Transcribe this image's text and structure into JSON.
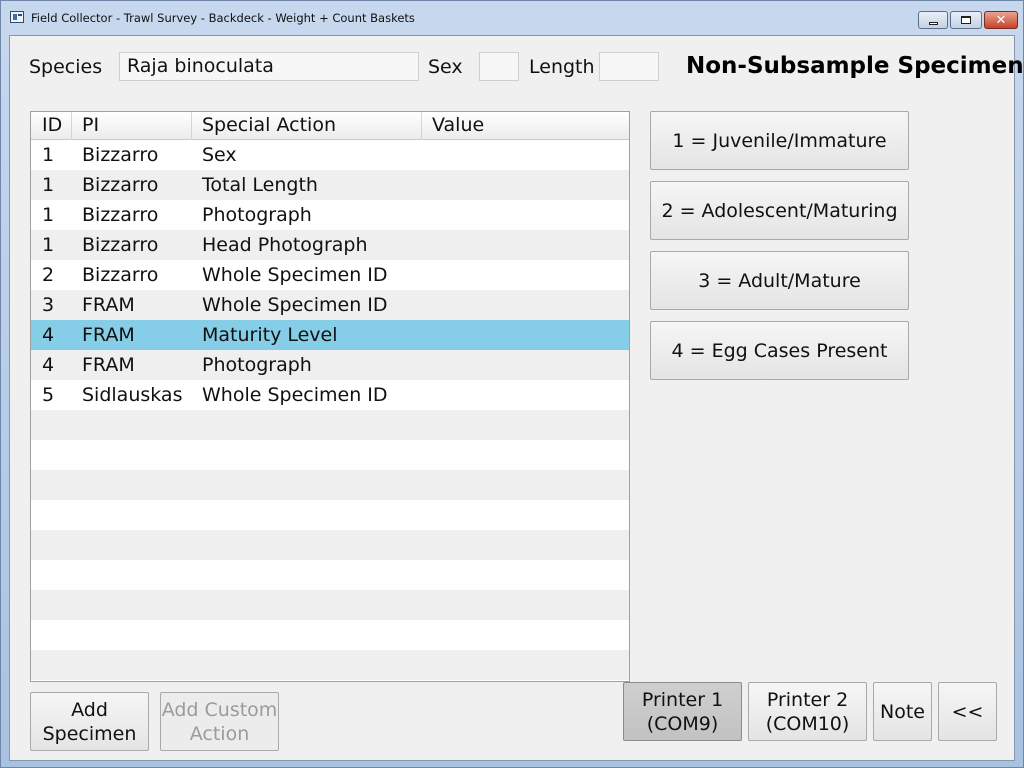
{
  "window": {
    "title": "Field Collector - Trawl Survey - Backdeck - Weight + Count Baskets",
    "minimize_label": "",
    "maximize_label": "",
    "close_label": "✕"
  },
  "form": {
    "species_label": "Species",
    "species_value": "Raja binoculata",
    "sex_label": "Sex",
    "sex_value": "",
    "length_label": "Length",
    "length_value": "",
    "heading": "Non-Subsample Specimen"
  },
  "table": {
    "columns": [
      "ID",
      "PI",
      "Special Action",
      "Value"
    ],
    "rows": [
      {
        "id": "1",
        "pi": "Bizzarro",
        "action": "Sex",
        "value": ""
      },
      {
        "id": "1",
        "pi": "Bizzarro",
        "action": "Total Length",
        "value": ""
      },
      {
        "id": "1",
        "pi": "Bizzarro",
        "action": "Photograph",
        "value": ""
      },
      {
        "id": "1",
        "pi": "Bizzarro",
        "action": "Head Photograph",
        "value": ""
      },
      {
        "id": "2",
        "pi": "Bizzarro",
        "action": "Whole Specimen ID",
        "value": ""
      },
      {
        "id": "3",
        "pi": "FRAM",
        "action": "Whole Specimen ID",
        "value": ""
      },
      {
        "id": "4",
        "pi": "FRAM",
        "action": "Maturity Level",
        "value": "",
        "selected": true
      },
      {
        "id": "4",
        "pi": "FRAM",
        "action": "Photograph",
        "value": ""
      },
      {
        "id": "5",
        "pi": "Sidlauskas",
        "action": "Whole Specimen ID",
        "value": ""
      }
    ],
    "empty_rows": 9,
    "selected_color": "#86cee8"
  },
  "maturity_options": [
    "1 = Juvenile/Immature",
    "2 = Adolescent/Maturing",
    "3 = Adult/Mature",
    "4 = Egg Cases Present"
  ],
  "bottom": {
    "add_specimen": [
      "Add",
      "Specimen"
    ],
    "add_custom_action": [
      "Add Custom",
      "Action"
    ],
    "printer1": [
      "Printer 1",
      "(COM9)"
    ],
    "printer2": [
      "Printer 2",
      "(COM10)"
    ],
    "note": "Note",
    "back": "<<"
  }
}
